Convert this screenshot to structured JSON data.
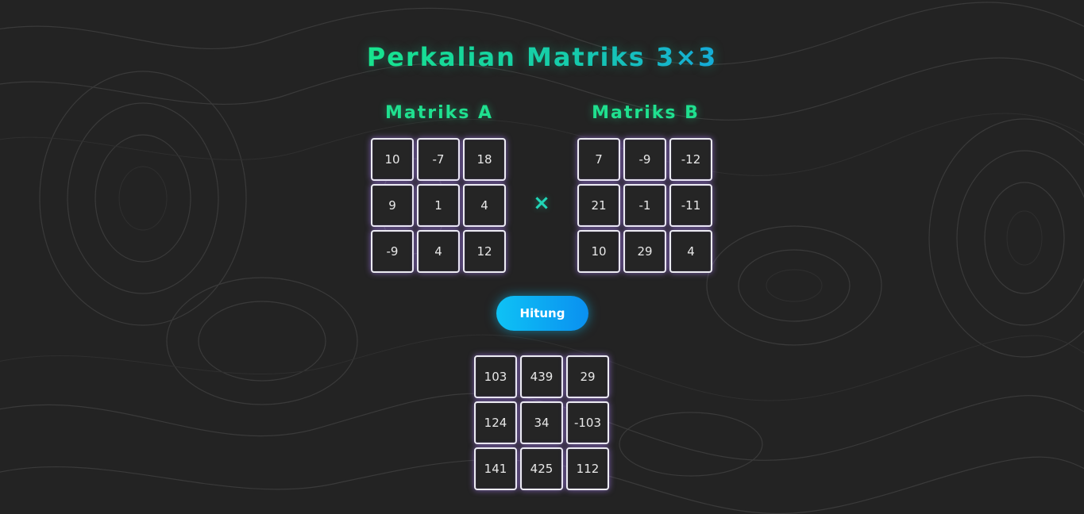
{
  "title": "Perkalian Matriks 3×3",
  "matrix_a": {
    "label": "Matriks A",
    "values": [
      "10",
      "-7",
      "18",
      "9",
      "1",
      "4",
      "-9",
      "4",
      "12"
    ]
  },
  "matrix_b": {
    "label": "Matriks B",
    "values": [
      "7",
      "-9",
      "-12",
      "21",
      "-1",
      "-11",
      "10",
      "29",
      "4"
    ]
  },
  "operator": "×",
  "calculate_button": "Hitung",
  "result": {
    "values": [
      "103",
      "439",
      "29",
      "124",
      "34",
      "-103",
      "141",
      "425",
      "112"
    ]
  },
  "colors": {
    "background": "#232323",
    "accent_green": "#1fe08f",
    "accent_blue": "#0ec2f5",
    "cell_glow": "#af82ff"
  }
}
